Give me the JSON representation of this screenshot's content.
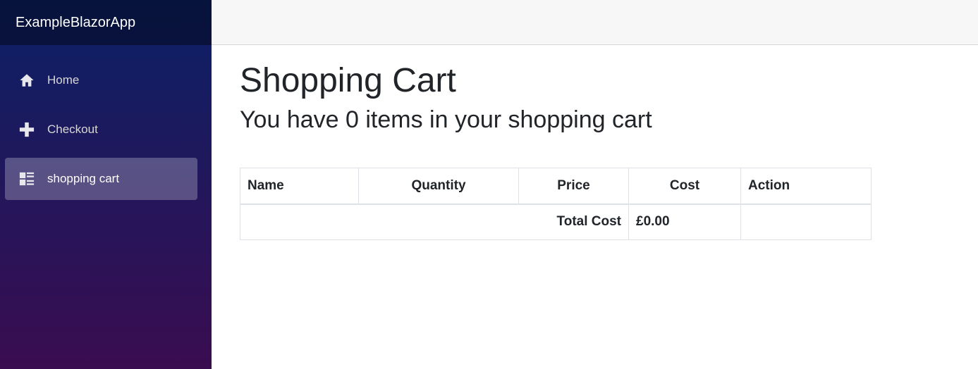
{
  "app": {
    "brand": "ExampleBlazorApp"
  },
  "sidebar": {
    "items": [
      {
        "label": "Home",
        "icon": "home-icon",
        "active": false
      },
      {
        "label": "Checkout",
        "icon": "plus-icon",
        "active": false
      },
      {
        "label": "shopping cart",
        "icon": "list-rich-icon",
        "active": true
      }
    ]
  },
  "main": {
    "title": "Shopping Cart",
    "subtitle": "You have 0 items in your shopping cart",
    "table": {
      "headers": [
        "Name",
        "Quantity",
        "Price",
        "Cost",
        "Action"
      ],
      "total_label": "Total Cost",
      "total_value": "£0.00"
    }
  },
  "colors": {
    "sidebar_top": "#0b2166",
    "sidebar_bottom": "#3a0c50",
    "top_row": "#f7f7f7"
  }
}
